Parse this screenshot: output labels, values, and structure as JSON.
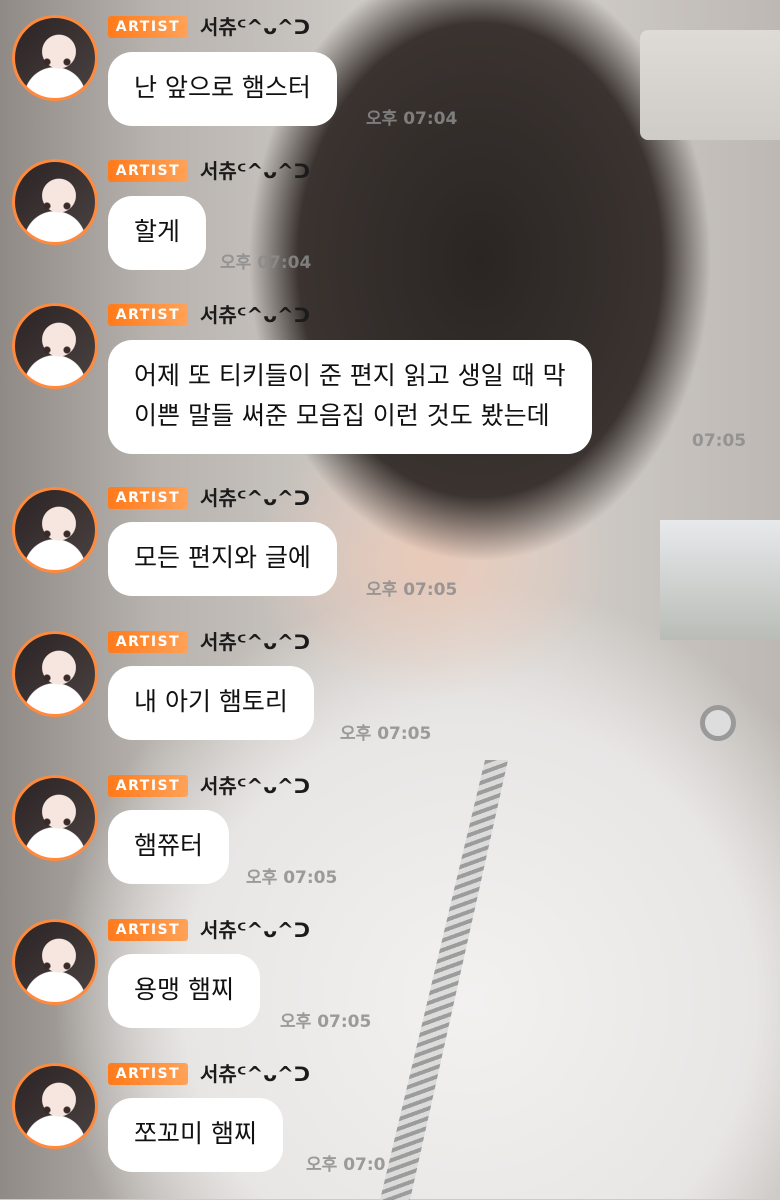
{
  "badge_label": "ARTIST",
  "sender_name": "서츄ᑦ^ᴗ^ᑐ",
  "accent_color": "#ff8a3d",
  "messages": [
    {
      "text": "난 앞으로 햄스터",
      "time": "오후 07:04"
    },
    {
      "text": "할게",
      "time": "오후 07:04"
    },
    {
      "text": "어제 또 티키들이 준 편지 읽고 생일 때 막\n이쁜 말들 써준 모음집 이런 것도 봤는데",
      "time": "07:05"
    },
    {
      "text": "모든 편지와 글에",
      "time": "오후 07:05"
    },
    {
      "text": "내 아기 햄토리",
      "time": "오후 07:05"
    },
    {
      "text": "햄쮸터",
      "time": "오후 07:05"
    },
    {
      "text": "용맹 햄찌",
      "time": "오후 07:05"
    },
    {
      "text": "쪼꼬미 햄찌",
      "time": "오후 07:0"
    }
  ]
}
